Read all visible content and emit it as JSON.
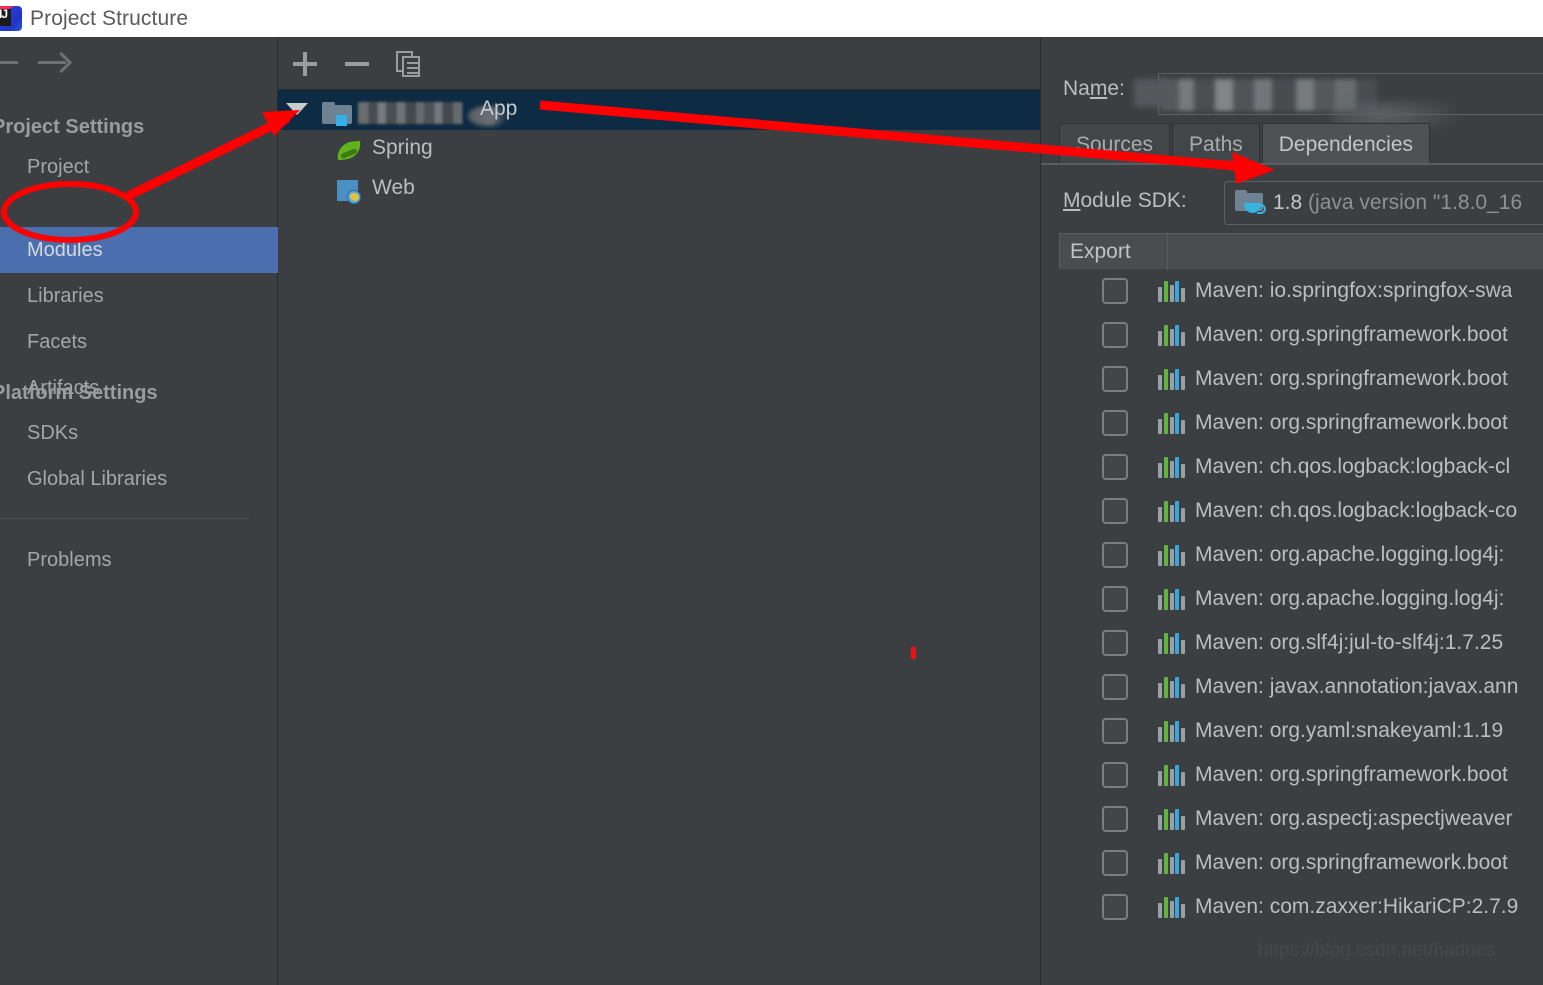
{
  "window": {
    "title": "Project Structure",
    "logo_icon": "intellij-idea-logo"
  },
  "nav": {
    "back_icon": "arrow-back-icon",
    "forward_icon": "arrow-forward-icon"
  },
  "sidebar": {
    "groups": [
      {
        "title": "Project Settings",
        "items": [
          {
            "label": "Project",
            "selected": false
          },
          {
            "label": "Modules",
            "selected": true
          },
          {
            "label": "Libraries",
            "selected": false
          },
          {
            "label": "Facets",
            "selected": false
          },
          {
            "label": "Artifacts",
            "selected": false
          }
        ]
      },
      {
        "title": "Platform Settings",
        "items": [
          {
            "label": "SDKs",
            "selected": false
          },
          {
            "label": "Global Libraries",
            "selected": false
          }
        ]
      }
    ],
    "footer_items": [
      {
        "label": "Problems",
        "selected": false
      }
    ]
  },
  "module_panel": {
    "toolbar": {
      "add_label": "+",
      "add_icon": "plus-icon",
      "remove_label": "−",
      "remove_icon": "minus-icon",
      "copy_icon": "copy-icon"
    },
    "tree": {
      "root": {
        "label": "App",
        "name_redacted": true,
        "icon": "module-folder-icon",
        "expanded": true,
        "selected": true
      },
      "children": [
        {
          "label": "Spring",
          "icon": "spring-leaf-icon"
        },
        {
          "label": "Web",
          "icon": "web-globe-icon"
        }
      ]
    }
  },
  "details_panel": {
    "name_field": {
      "label": "Name:",
      "label_mnemonic": "m",
      "value": "",
      "redacted": true
    },
    "tabs": [
      {
        "label": "Sources",
        "active": false
      },
      {
        "label": "Paths",
        "active": false
      },
      {
        "label": "Dependencies",
        "active": true
      }
    ],
    "module_sdk": {
      "label": "Module SDK:",
      "label_mnemonic": "M",
      "icon": "java-sdk-icon",
      "version": "1.8",
      "version_detail": "(java version \"1.8.0_16"
    },
    "table": {
      "columns": [
        "Export"
      ],
      "rows": [
        {
          "checked": false,
          "icon": "maven-library-icon",
          "label": "Maven: io.springfox:springfox-swa"
        },
        {
          "checked": false,
          "icon": "maven-library-icon",
          "label": "Maven: org.springframework.boot"
        },
        {
          "checked": false,
          "icon": "maven-library-icon",
          "label": "Maven: org.springframework.boot"
        },
        {
          "checked": false,
          "icon": "maven-library-icon",
          "label": "Maven: org.springframework.boot"
        },
        {
          "checked": false,
          "icon": "maven-library-icon",
          "label": "Maven: ch.qos.logback:logback-cl"
        },
        {
          "checked": false,
          "icon": "maven-library-icon",
          "label": "Maven: ch.qos.logback:logback-co"
        },
        {
          "checked": false,
          "icon": "maven-library-icon",
          "label": "Maven: org.apache.logging.log4j:"
        },
        {
          "checked": false,
          "icon": "maven-library-icon",
          "label": "Maven: org.apache.logging.log4j:"
        },
        {
          "checked": false,
          "icon": "maven-library-icon",
          "label": "Maven: org.slf4j:jul-to-slf4j:1.7.25"
        },
        {
          "checked": false,
          "icon": "maven-library-icon",
          "label": "Maven: javax.annotation:javax.ann"
        },
        {
          "checked": false,
          "icon": "maven-library-icon",
          "label": "Maven: org.yaml:snakeyaml:1.19"
        },
        {
          "checked": false,
          "icon": "maven-library-icon",
          "label": "Maven: org.springframework.boot"
        },
        {
          "checked": false,
          "icon": "maven-library-icon",
          "label": "Maven: org.aspectj:aspectjweaver"
        },
        {
          "checked": false,
          "icon": "maven-library-icon",
          "label": "Maven: org.springframework.boot"
        },
        {
          "checked": false,
          "icon": "maven-library-icon",
          "label": "Maven: com.zaxxer:HikariCP:2.7.9"
        }
      ]
    }
  },
  "watermark": {
    "text": "https://blog.csdn.net/hadues"
  },
  "annotations": {
    "color": "#ff0000",
    "ellipse_target": "Modules",
    "arrow_1": "points from Modules sidebar item to module tree root",
    "arrow_2": "points from module tree root to Dependencies tab"
  },
  "colors": {
    "panel_bg": "#3c3f41",
    "titlebar_bg": "#ffffff",
    "sidebar_selected": "#4b6eaf",
    "tree_selected": "#0d2b43",
    "tab_active": "#4e5254",
    "accent_red": "#ff0000",
    "text": "#bbbdbf"
  }
}
